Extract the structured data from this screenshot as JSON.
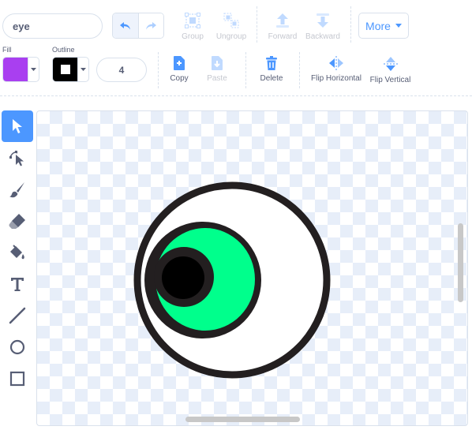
{
  "costume": {
    "name": "eye"
  },
  "toolbar": {
    "group": "Group",
    "ungroup": "Ungroup",
    "forward": "Forward",
    "backward": "Backward",
    "more": "More",
    "copy": "Copy",
    "paste": "Paste",
    "delete": "Delete",
    "flip_horizontal": "Flip Horizontal",
    "flip_vertical": "Flip Vertical"
  },
  "fill": {
    "label": "Fill",
    "color": "#a93ff0"
  },
  "outline": {
    "label": "Outline",
    "color": "#000000",
    "width": "4"
  },
  "tools": [
    "select-tool",
    "reshape-tool",
    "brush-tool",
    "eraser-tool",
    "fill-tool",
    "text-tool",
    "line-tool",
    "circle-tool",
    "rectangle-tool"
  ],
  "colors": {
    "accent": "#4c97ff",
    "eye_white": "#ffffff",
    "eye_outline": "#231f20",
    "iris": "#00ff8c",
    "pupil": "#000000"
  }
}
